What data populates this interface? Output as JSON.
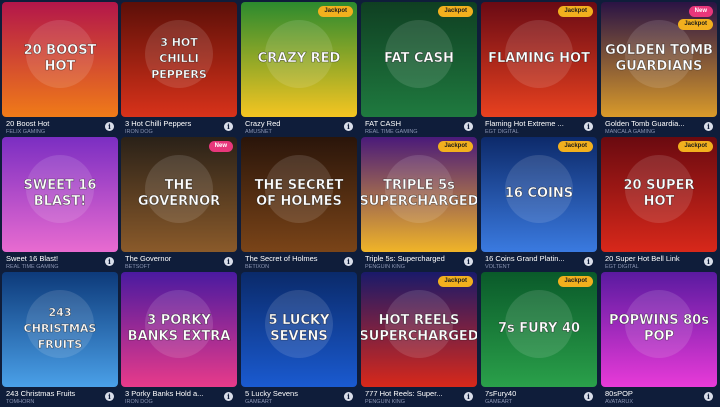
{
  "info_icon": "info-icon",
  "games": [
    {
      "title": "20 Boost Hot",
      "provider": "FELIX GAMING",
      "art": "20 BOOST HOT",
      "badges": [],
      "colors": [
        "#b3164a",
        "#f07b18"
      ]
    },
    {
      "title": "3 Hot Chilli Peppers",
      "provider": "IRON DOG",
      "art": "3 HOT CHILLI PEPPERS",
      "badges": [],
      "colors": [
        "#5c0f08",
        "#d8321a"
      ]
    },
    {
      "title": "Crazy Red",
      "provider": "AMUSNET",
      "art": "CRAZY RED",
      "badges": [
        "Jackpot"
      ],
      "colors": [
        "#2c8a2e",
        "#f5c521"
      ]
    },
    {
      "title": "FAT CASH",
      "provider": "REAL TIME GAMING",
      "art": "FAT CASH",
      "badges": [
        "Jackpot"
      ],
      "colors": [
        "#0f3f22",
        "#1f7a3f"
      ]
    },
    {
      "title": "Flaming Hot Extreme ...",
      "provider": "EGT DIGITAL",
      "art": "FLAMING HOT",
      "badges": [
        "Jackpot"
      ],
      "colors": [
        "#6a0a14",
        "#e8411f"
      ]
    },
    {
      "title": "Golden Tomb Guardia...",
      "provider": "MANCALA GAMING",
      "art": "GOLDEN TOMB GUARDIANS",
      "badges": [
        "New",
        "Jackpot"
      ],
      "colors": [
        "#2a1345",
        "#d99a2a"
      ]
    },
    {
      "title": "Sweet 16 Blast!",
      "provider": "REAL TIME GAMING",
      "art": "SWEET 16 BLAST!",
      "badges": [],
      "colors": [
        "#7b2ec2",
        "#e86bd0"
      ]
    },
    {
      "title": "The Governor",
      "provider": "BETSOFT",
      "art": "THE GOVERNOR",
      "badges": [
        "New"
      ],
      "colors": [
        "#2a2118",
        "#8a5a2a"
      ]
    },
    {
      "title": "The Secret of Holmes",
      "provider": "BETIXON",
      "art": "THE SECRET OF HOLMES",
      "badges": [],
      "colors": [
        "#2a150a",
        "#7a4418"
      ]
    },
    {
      "title": "Triple 5s: Supercharged",
      "provider": "PENGUIN KING",
      "art": "TRIPLE 5s SUPERCHARGED",
      "badges": [
        "Jackpot"
      ],
      "colors": [
        "#4a1a7a",
        "#f0b428"
      ]
    },
    {
      "title": "16 Coins Grand Platin...",
      "provider": "VOLTENT",
      "art": "16 COINS",
      "badges": [
        "Jackpot"
      ],
      "colors": [
        "#0d2a6a",
        "#3a7ae0"
      ]
    },
    {
      "title": "20 Super Hot Bell Link",
      "provider": "EGT DIGITAL",
      "art": "20 SUPER HOT",
      "badges": [
        "Jackpot"
      ],
      "colors": [
        "#6a0a10",
        "#d8281a"
      ]
    },
    {
      "title": "243 Christmas Fruits",
      "provider": "TOMHORN",
      "art": "243 CHRISTMAS FRUITS",
      "badges": [],
      "colors": [
        "#0d3a7a",
        "#4aa0e8"
      ]
    },
    {
      "title": "3 Porky Banks Hold a...",
      "provider": "IRON DOG",
      "art": "3 PORKY BANKS EXTRA",
      "badges": [],
      "colors": [
        "#4a1aa0",
        "#e83a8a"
      ]
    },
    {
      "title": "5 Lucky Sevens",
      "provider": "GAMEART",
      "art": "5 LUCKY SEVENS",
      "badges": [],
      "colors": [
        "#0a2a6a",
        "#1a5ad0"
      ]
    },
    {
      "title": "777 Hot Reels: Super...",
      "provider": "PENGUIN KING",
      "art": "HOT REELS SUPERCHARGED",
      "badges": [
        "Jackpot"
      ],
      "colors": [
        "#1a1a6a",
        "#d8281a"
      ]
    },
    {
      "title": "7sFury40",
      "provider": "GAMEART",
      "art": "7s FURY 40",
      "badges": [
        "Jackpot"
      ],
      "colors": [
        "#0a5a2a",
        "#2aa04a"
      ]
    },
    {
      "title": "80sPOP",
      "provider": "AVATARUX",
      "art": "POPWINS 80s POP",
      "badges": [],
      "colors": [
        "#5a1aa0",
        "#e83ad8"
      ]
    }
  ]
}
